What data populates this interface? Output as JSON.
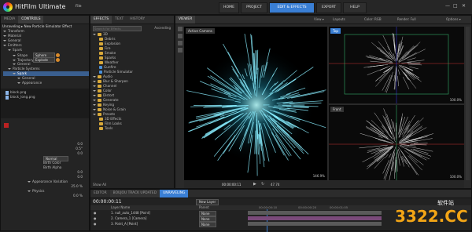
{
  "app": {
    "title": "HitFilm Ultimate",
    "menu": "File"
  },
  "nav": [
    "HOME",
    "PROJECT",
    "EDIT & EFFECTS",
    "EXPORT",
    "HELP"
  ],
  "nav_active": 2,
  "left": {
    "tabs": [
      "MEDIA",
      "CONTROLS"
    ],
    "header": "Unraveling ▸ New Particle Simulator Effect",
    "tree": [
      "Transform",
      "Material",
      "General",
      "Emitters",
      "Spark",
      "Shape",
      "Trajectory",
      "General",
      "Particle Systems",
      "Spark",
      "General",
      "Appearance"
    ],
    "shape_value": "Sphere",
    "trajectory_value": "Explode",
    "media": [
      "block.png",
      "block_long.png"
    ],
    "props": [
      "Normal",
      "Birth Color",
      "Birth Alpha",
      "Appearance Variation",
      "Physics"
    ],
    "numbers": [
      "0.0",
      "0.5°",
      "0.0",
      "0.0",
      "0.0",
      "10.0",
      "35.0",
      "25.0 %",
      "0.0 %"
    ]
  },
  "effects": {
    "tabs": [
      "EFFECTS",
      "TEXT",
      "HISTORY"
    ],
    "search_placeholder": "Search for Effects",
    "sort_label": "Ascending",
    "items": [
      "3D",
      "Debris",
      "Explosion",
      "Fire",
      "Smoke",
      "Sparks",
      "Weather",
      "Gunfire",
      "Particle Simulator",
      "Audio",
      "Blur & Sharpen",
      "Channel",
      "Color",
      "Distort",
      "Generate",
      "Keying",
      "Noise & Grain",
      "Presets",
      "3D Effects",
      "Film Looks",
      "Tools"
    ],
    "footer": "Show All"
  },
  "viewer": {
    "title": "VIEWER",
    "toolbar": [
      "View ▾",
      "Layouts",
      "Color: RGB",
      "Render: Full",
      "Options ▾"
    ],
    "camera_label": "Active Camera",
    "zoom": "146.9%",
    "zoom2": "100.0%",
    "top_label": "Top",
    "front_label": "Front",
    "timecode": "00:00:00:11",
    "fps": "47.74"
  },
  "timeline": {
    "tabs": [
      "EDITOR",
      "BOUJOU TRACK UPDATED",
      "UNRAVELING"
    ],
    "timecode": "00:00:00:11",
    "new_layer": "New Layer",
    "layer_header": "Layer Name",
    "parent_header": "Parent",
    "layers": [
      "1. null_auto_1448 [Point]",
      "2. Camera_1 [Camera]",
      "3. Point_A [Point]"
    ],
    "parent": "None",
    "time_marks": [
      "00:00:00:10",
      "00:00:00:20",
      "00:00:01:05"
    ]
  },
  "watermark": {
    "text": "3322.CC",
    "sub": "软件站"
  }
}
